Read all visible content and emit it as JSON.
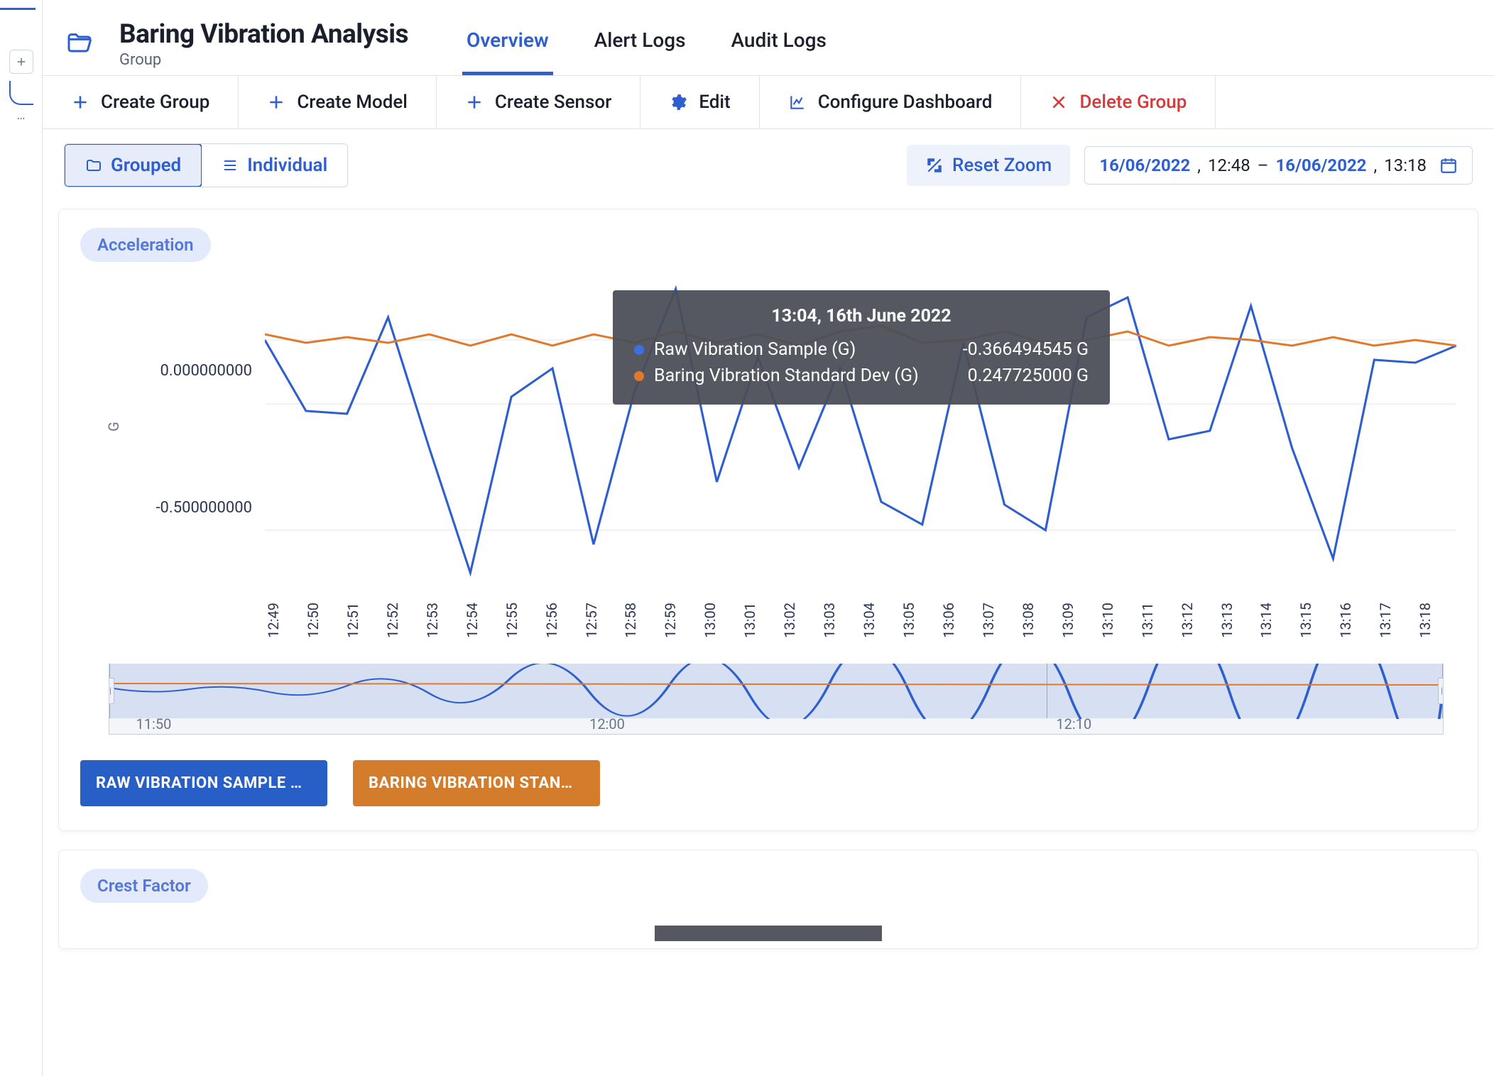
{
  "header": {
    "title": "Baring Vibration Analysis",
    "subtitle": "Group",
    "tabs": [
      "Overview",
      "Alert Logs",
      "Audit Logs"
    ],
    "active_tab": 0
  },
  "toolbar": {
    "create_group": "Create Group",
    "create_model": "Create Model",
    "create_sensor": "Create Sensor",
    "edit": "Edit",
    "configure_dashboard": "Configure Dashboard",
    "delete_group": "Delete Group"
  },
  "view_toggle": {
    "grouped": "Grouped",
    "individual": "Individual",
    "active": "grouped"
  },
  "reset_zoom": "Reset Zoom",
  "date_range": {
    "start_date": "16/06/2022",
    "start_time": "12:48",
    "end_date": "16/06/2022",
    "end_time": "13:18"
  },
  "charts": {
    "acceleration": {
      "pill": "Acceleration",
      "series_buttons": [
        "RAW VIBRATION SAMPLE …",
        "BARING VIBRATION STAN…"
      ]
    },
    "crest_factor": {
      "pill": "Crest Factor"
    }
  },
  "tooltip": {
    "title": "13:04, 16th June 2022",
    "rows": [
      {
        "label": "Raw Vibration Sample (G)",
        "value": "-0.366494545 G",
        "color": "#3d6fe0"
      },
      {
        "label": "Baring Vibration Standard Dev (G)",
        "value": "0.247725000 G",
        "color": "#e07a2a"
      }
    ]
  },
  "scrubber": {
    "ticks": [
      "11:50",
      "12:00",
      "12:10"
    ]
  },
  "chart_data": {
    "type": "line",
    "title": "Acceleration",
    "xlabel": "",
    "ylabel": "G",
    "ylim": [
      -0.7,
      0.4
    ],
    "categories": [
      "12:49",
      "12:50",
      "12:51",
      "12:52",
      "12:53",
      "12:54",
      "12:55",
      "12:56",
      "12:57",
      "12:58",
      "12:59",
      "13:00",
      "13:01",
      "13:02",
      "13:03",
      "13:04",
      "13:05",
      "13:06",
      "13:07",
      "13:08",
      "13:09",
      "13:10",
      "13:11",
      "13:12",
      "13:13",
      "13:14",
      "13:15",
      "13:16",
      "13:17",
      "13:18"
    ],
    "yticks": [
      0.0,
      -0.5
    ],
    "series": [
      {
        "name": "Raw Vibration Sample (G)",
        "color": "#2f5fcf",
        "values": [
          0.2,
          -0.05,
          -0.06,
          0.28,
          -0.18,
          -0.62,
          0.0,
          0.1,
          -0.52,
          0.02,
          0.38,
          -0.3,
          0.14,
          -0.25,
          0.1,
          -0.37,
          -0.45,
          0.19,
          -0.38,
          -0.47,
          0.28,
          0.35,
          -0.15,
          -0.12,
          0.32,
          -0.18,
          -0.57,
          0.13,
          0.12,
          0.18
        ]
      },
      {
        "name": "Baring Vibration Standard Dev (G)",
        "color": "#e07a2a",
        "values": [
          0.22,
          0.19,
          0.21,
          0.19,
          0.22,
          0.18,
          0.22,
          0.18,
          0.22,
          0.19,
          0.23,
          0.19,
          0.22,
          0.18,
          0.23,
          0.25,
          0.19,
          0.2,
          0.23,
          0.19,
          0.2,
          0.23,
          0.18,
          0.21,
          0.2,
          0.18,
          0.21,
          0.18,
          0.2,
          0.18
        ]
      }
    ]
  }
}
